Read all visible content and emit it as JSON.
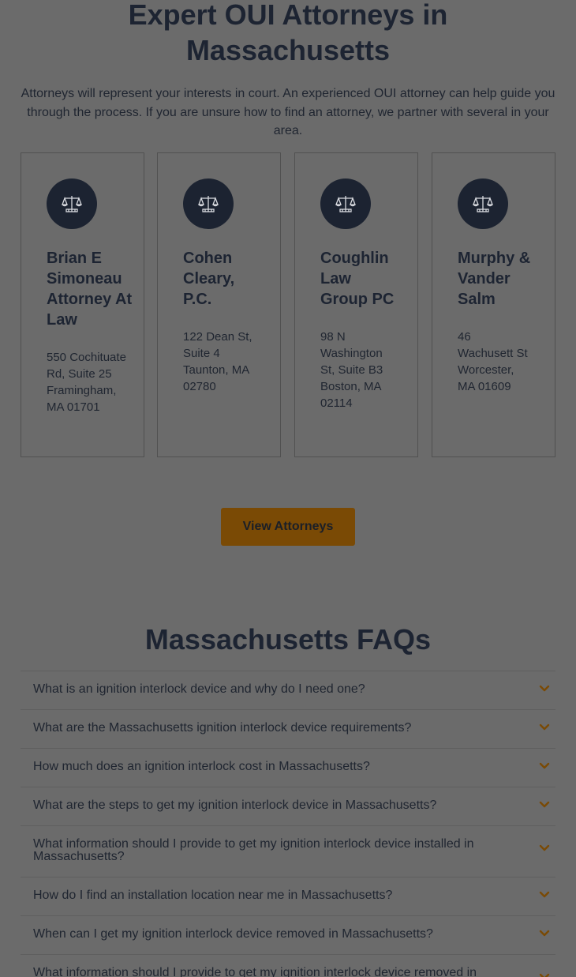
{
  "hero": {
    "title_line1": "Expert OUI Attorneys in",
    "title_line2": "Massachusetts",
    "description": "Attorneys will represent your interests in court. An experienced OUI attorney can help guide you through the process. If you are unsure how to find an attorney, we partner with several in your area."
  },
  "attorneys": [
    {
      "name": "Brian E Simoneau Attorney At Law",
      "address": "550 Cochituate Rd, Suite 25 Framingham, MA 01701",
      "icon": "scales-of-justice-icon"
    },
    {
      "name": "Cohen Cleary, P.C.",
      "address": "122 Dean St, Suite 4 Taunton, MA 02780",
      "icon": "scales-of-justice-icon"
    },
    {
      "name": "Coughlin Law Group PC",
      "address": "98 N Washington St, Suite B3 Boston, MA 02114",
      "icon": "scales-of-justice-icon"
    },
    {
      "name": "Murphy & Vander Salm",
      "address": "46 Wachusett St Worcester, MA 01609",
      "icon": "scales-of-justice-icon"
    }
  ],
  "view_button": {
    "label": "View Attorneys"
  },
  "faq": {
    "title": "Massachusetts FAQs",
    "items": [
      {
        "question": "What is an ignition interlock device and why do I need one?"
      },
      {
        "question": "What are the Massachusetts ignition interlock device requirements?"
      },
      {
        "question": "How much does an ignition interlock cost in Massachusetts?"
      },
      {
        "question": "What are the steps to get my ignition interlock device in Massachusetts?"
      },
      {
        "question": "What information should I provide to get my ignition interlock device installed in Massachusetts?"
      },
      {
        "question": "How do I find an installation location near me in Massachusetts?"
      },
      {
        "question": "When can I get my ignition interlock device removed in Massachusetts?"
      },
      {
        "question": "What information should I provide to get my ignition interlock device removed in Massachusetts?"
      }
    ]
  },
  "colors": {
    "overlay_background": "#6b6b6b",
    "heading": "#1d2432",
    "badge": "#1c2331",
    "button": "#7a4a05",
    "chevron": "#7a4a05"
  }
}
